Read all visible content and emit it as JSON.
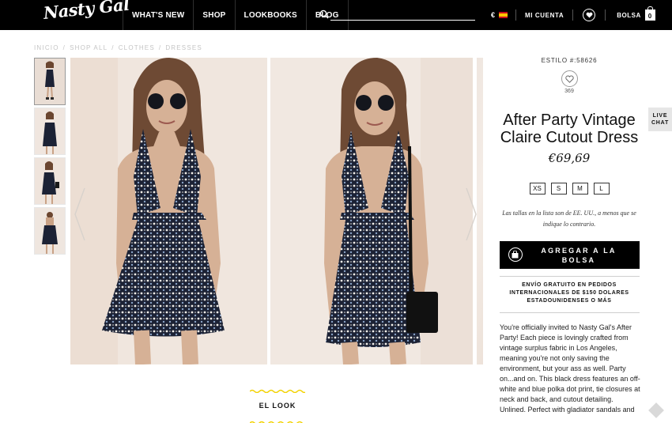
{
  "header": {
    "logo_text": "Nasty Gal",
    "nav": [
      "WHAT'S NEW",
      "SHOP",
      "LOOKBOOKS",
      "BLOG"
    ],
    "search_placeholder": "",
    "currency_symbol": "€",
    "account_label": "MI CUENTA",
    "bag_label": "BOLSA",
    "bag_count": "0"
  },
  "breadcrumb": [
    "INICIO",
    "/",
    "SHOP ALL",
    "/",
    "CLOTHES",
    "/",
    "DRESSES"
  ],
  "product": {
    "style": "ESTILO #:58626",
    "likes": "369",
    "title": "After Party Vintage Claire Cutout Dress",
    "price": "€69,69",
    "sizes": [
      "XS",
      "S",
      "M",
      "L"
    ],
    "size_note": "Las tallas en la lista son de EE. UU., a menos que se indique lo contrario.",
    "add_to_bag": "AGREGAR A LA BOLSA",
    "shipping": "ENVÍO GRATUITO EN PEDIDOS INTERNACIONALES DE $150 DOLARES ESTADOUNIDENSES O MÁS",
    "description": "You're officially invited to Nasty Gal's After Party! Each piece is lovingly crafted from vintage surplus fabric in Los Angeles, meaning you're not only saving the environment, but your ass as well. Party on...and on. This black dress features an off-white and blue polka dot print, tie closures at neck and back, and cutout detailing. Unlined. Perfect with gladiator sandals and"
  },
  "look_label": "EL LOOK",
  "live_chat": "LIVE CHAT",
  "colors": {
    "header_bg": "#000000",
    "accent_yellow": "#f2d200",
    "photo_bg": "#efe6df",
    "dress": "#1c2235"
  }
}
